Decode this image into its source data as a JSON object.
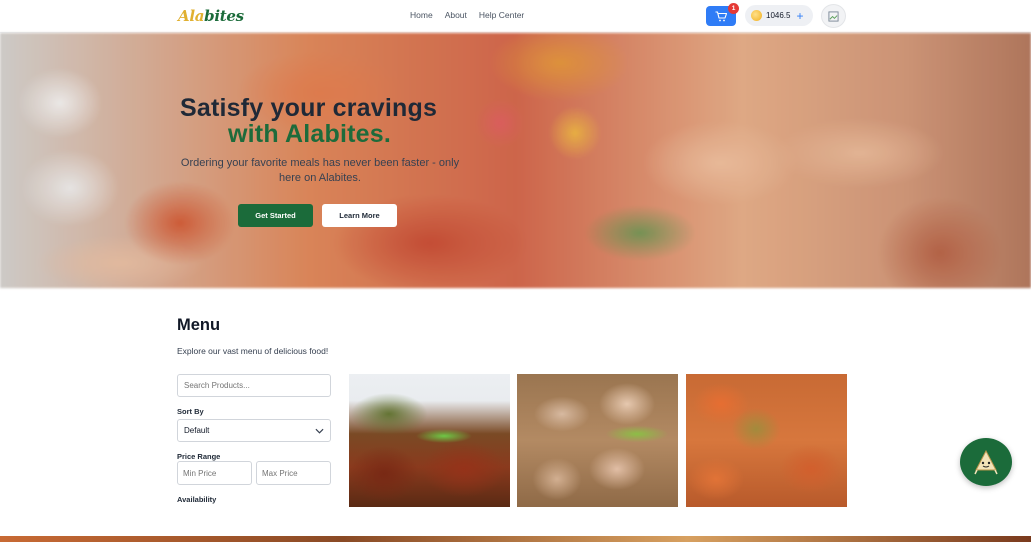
{
  "navbar": {
    "logo_part1": "Ala",
    "logo_part2": "bites",
    "links": [
      "Home",
      "About",
      "Help Center"
    ],
    "cart_count": "1",
    "coin_balance": "1046.5",
    "accent": "#2f7cf6"
  },
  "hero": {
    "title_line1": "Satisfy your cravings",
    "title_line2": "with Alabites.",
    "subtitle": "Ordering your favorite meals has never been faster - only here on Alabites.",
    "get_started_label": "Get Started",
    "learn_more_label": "Learn More",
    "brand_green": "#1b6b3a"
  },
  "menu": {
    "title": "Menu",
    "subtitle": "Explore our vast menu of delicious food!",
    "search_placeholder": "Search Products...",
    "sort_label": "Sort By",
    "sort_value": "Default",
    "price_range_label": "Price Range",
    "min_price_placeholder": "Min Price",
    "max_price_placeholder": "Max Price",
    "availability_label": "Availability"
  },
  "icons": {
    "cart": "cart-icon",
    "coin": "coin-icon",
    "plus": "plus-icon",
    "avatar": "broken-image-icon",
    "chevron": "chevron-down-icon",
    "fab": "mascot-icon"
  }
}
